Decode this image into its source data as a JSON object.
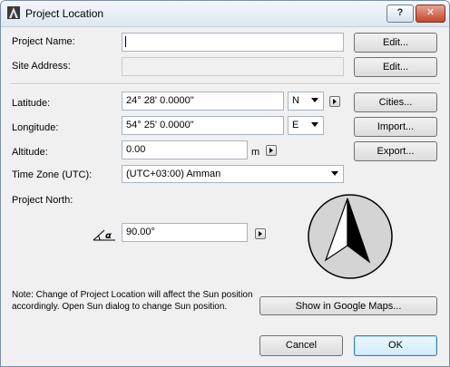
{
  "window": {
    "title": "Project Location",
    "help_label": "?",
    "close_label": "✕"
  },
  "project_name": {
    "label": "Project Name:",
    "value": "",
    "edit_label": "Edit..."
  },
  "site_address": {
    "label": "Site Address:",
    "value": "",
    "edit_label": "Edit..."
  },
  "latitude": {
    "label": "Latitude:",
    "value": "24° 28' 0.0000\"",
    "hemisphere": "N"
  },
  "longitude": {
    "label": "Longitude:",
    "value": "54° 25' 0.0000\"",
    "hemisphere": "E"
  },
  "altitude": {
    "label": "Altitude:",
    "value": "0.00",
    "unit": "m"
  },
  "timezone": {
    "label": "Time Zone (UTC):",
    "value": "(UTC+03:00) Amman"
  },
  "project_north": {
    "label": "Project North:",
    "value": "90.00°",
    "angle_symbol": "α"
  },
  "side_buttons": {
    "cities": "Cities...",
    "import": "Import...",
    "export": "Export..."
  },
  "note": "Note: Change of Project Location will affect the Sun position accordingly. Open Sun dialog to change Sun position.",
  "google_maps_label": "Show in Google Maps...",
  "footer": {
    "cancel_label": "Cancel",
    "ok_label": "OK"
  },
  "colors": {
    "ok_border": "#3c7fb1",
    "compass_fill": "#d4d4d4"
  }
}
